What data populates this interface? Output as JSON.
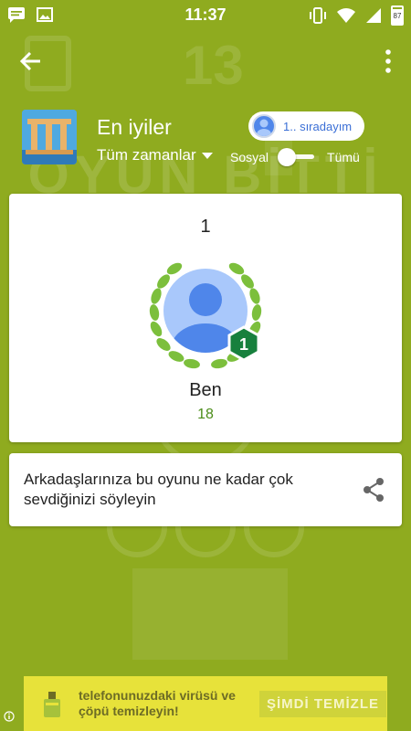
{
  "status_bar": {
    "time": "11:37",
    "battery": "87",
    "icons": [
      "message-icon",
      "image-icon",
      "vibrate-icon",
      "wifi-icon",
      "signal-icon",
      "battery-icon"
    ]
  },
  "app_bar": {
    "back_icon": "arrow-left-icon",
    "menu_icon": "more-vert-icon"
  },
  "background": {
    "title": "OYUN BİTTİ"
  },
  "leaderboard": {
    "title": "En iyiler",
    "time_filter": "Tüm zamanlar",
    "rank_pill": "1.. sıradayım",
    "toggle_left": "Sosyal",
    "toggle_right": "Tümü"
  },
  "player": {
    "rank": "1",
    "level_badge": "1",
    "name": "Ben",
    "score": "18"
  },
  "share": {
    "text": "Arkadaşlarınıza bu oyunu ne kadar çok sevdiğinizi söyleyin",
    "icon": "share-icon"
  },
  "ad": {
    "text": "telefonunuzdaki virüsü ve çöpü temizleyin!",
    "button": "ŞİMDİ TEMİZLE"
  },
  "colors": {
    "background": "#8fab1f",
    "score": "#4a8c18",
    "badge": "#17803d",
    "laurel": "#7cbf3c",
    "avatar": "#4f86ea",
    "avatar_bg": "#a9c8fb"
  }
}
